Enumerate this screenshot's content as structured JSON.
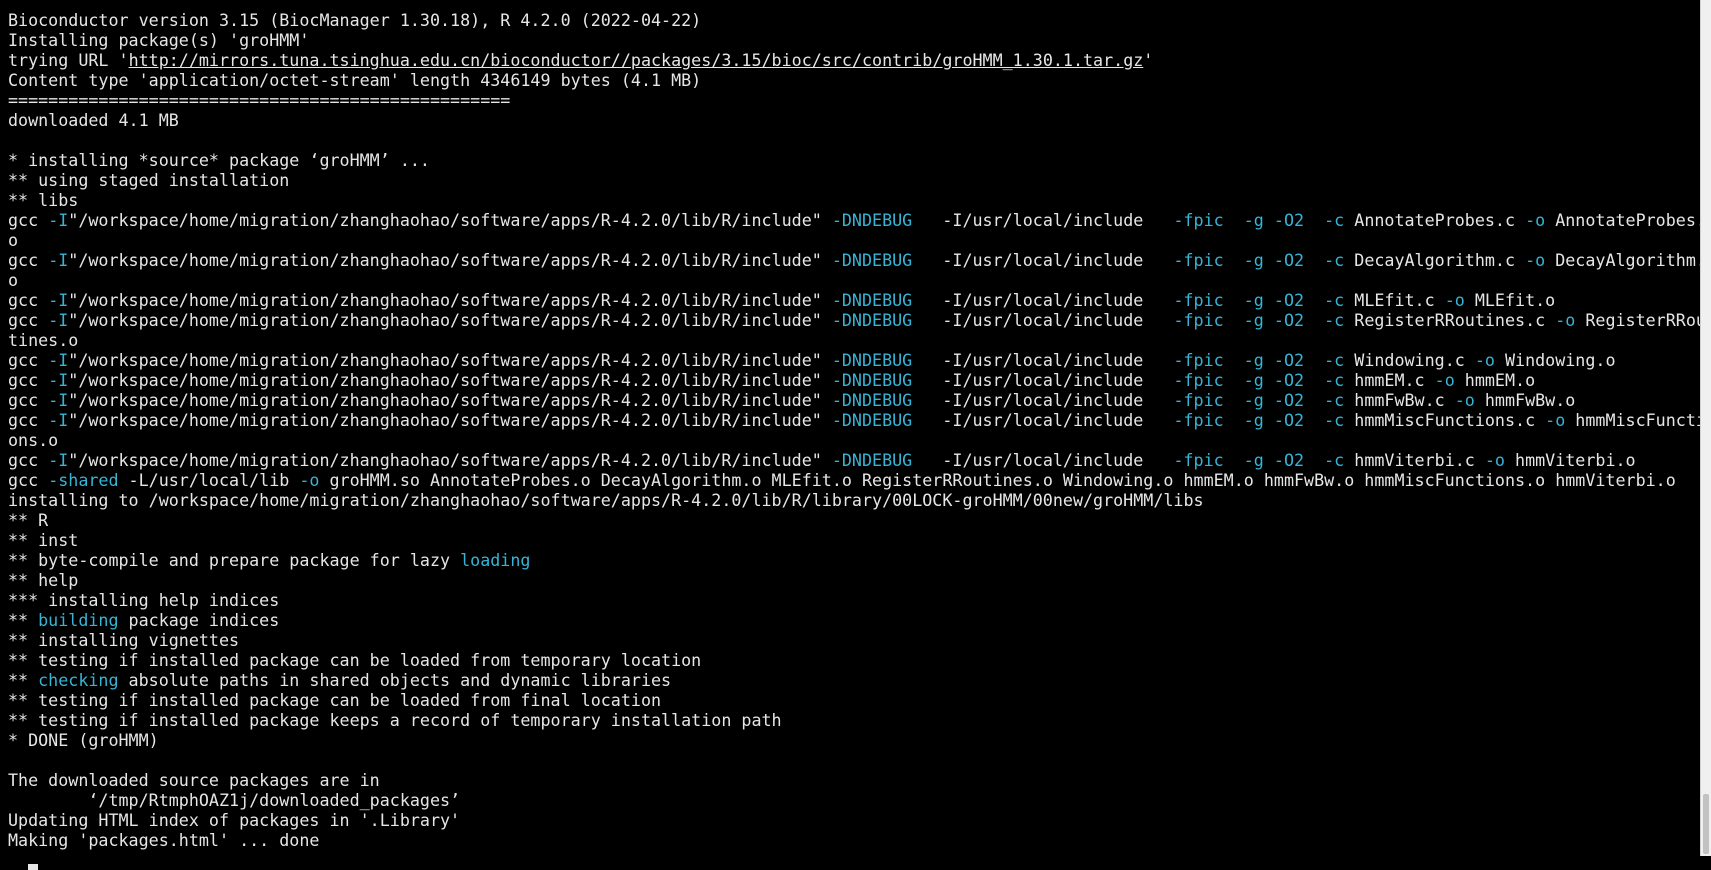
{
  "terminal": {
    "lines": [
      [
        {
          "t": "Bioconductor version 3.15 (BiocManager 1.30.18), R 4.2.0 (2022-04-22)"
        }
      ],
      [
        {
          "t": "Installing package(s) 'groHMM'"
        }
      ],
      [
        {
          "t": "trying URL '"
        },
        {
          "t": "http://mirrors.tuna.tsinghua.edu.cn/bioconductor//packages/3.15/bioc/src/contrib/groHMM_1.30.1.tar.gz",
          "c": "link"
        },
        {
          "t": "'"
        }
      ],
      [
        {
          "t": "Content type 'application/octet-stream' length 4346149 bytes (4.1 MB)"
        }
      ],
      [
        {
          "t": "=================================================="
        }
      ],
      [
        {
          "t": "downloaded 4.1 MB"
        }
      ],
      [
        {
          "t": ""
        }
      ],
      [
        {
          "t": "* installing *source* package ‘groHMM’ ..."
        }
      ],
      [
        {
          "t": "** using staged installation"
        }
      ],
      [
        {
          "t": "** libs"
        }
      ],
      [
        {
          "t": "gcc "
        },
        {
          "t": "-I",
          "c": "opt"
        },
        {
          "t": "\"/workspace/home/migration/zhanghaohao/software/apps/R-4.2.0/lib/R/include\" "
        },
        {
          "t": "-DNDEBUG",
          "c": "opt"
        },
        {
          "t": "   -I/usr/local/include   "
        },
        {
          "t": "-fpic",
          "c": "opt"
        },
        {
          "t": "  "
        },
        {
          "t": "-g",
          "c": "opt"
        },
        {
          "t": " "
        },
        {
          "t": "-O2",
          "c": "opt"
        },
        {
          "t": "  "
        },
        {
          "t": "-c",
          "c": "opt"
        },
        {
          "t": " AnnotateProbes.c "
        },
        {
          "t": "-o",
          "c": "opt"
        },
        {
          "t": " AnnotateProbes."
        }
      ],
      [
        {
          "t": "o"
        }
      ],
      [
        {
          "t": "gcc "
        },
        {
          "t": "-I",
          "c": "opt"
        },
        {
          "t": "\"/workspace/home/migration/zhanghaohao/software/apps/R-4.2.0/lib/R/include\" "
        },
        {
          "t": "-DNDEBUG",
          "c": "opt"
        },
        {
          "t": "   -I/usr/local/include   "
        },
        {
          "t": "-fpic",
          "c": "opt"
        },
        {
          "t": "  "
        },
        {
          "t": "-g",
          "c": "opt"
        },
        {
          "t": " "
        },
        {
          "t": "-O2",
          "c": "opt"
        },
        {
          "t": "  "
        },
        {
          "t": "-c",
          "c": "opt"
        },
        {
          "t": " DecayAlgorithm.c "
        },
        {
          "t": "-o",
          "c": "opt"
        },
        {
          "t": " DecayAlgorithm."
        }
      ],
      [
        {
          "t": "o"
        }
      ],
      [
        {
          "t": "gcc "
        },
        {
          "t": "-I",
          "c": "opt"
        },
        {
          "t": "\"/workspace/home/migration/zhanghaohao/software/apps/R-4.2.0/lib/R/include\" "
        },
        {
          "t": "-DNDEBUG",
          "c": "opt"
        },
        {
          "t": "   -I/usr/local/include   "
        },
        {
          "t": "-fpic",
          "c": "opt"
        },
        {
          "t": "  "
        },
        {
          "t": "-g",
          "c": "opt"
        },
        {
          "t": " "
        },
        {
          "t": "-O2",
          "c": "opt"
        },
        {
          "t": "  "
        },
        {
          "t": "-c",
          "c": "opt"
        },
        {
          "t": " MLEfit.c "
        },
        {
          "t": "-o",
          "c": "opt"
        },
        {
          "t": " MLEfit.o"
        }
      ],
      [
        {
          "t": "gcc "
        },
        {
          "t": "-I",
          "c": "opt"
        },
        {
          "t": "\"/workspace/home/migration/zhanghaohao/software/apps/R-4.2.0/lib/R/include\" "
        },
        {
          "t": "-DNDEBUG",
          "c": "opt"
        },
        {
          "t": "   -I/usr/local/include   "
        },
        {
          "t": "-fpic",
          "c": "opt"
        },
        {
          "t": "  "
        },
        {
          "t": "-g",
          "c": "opt"
        },
        {
          "t": " "
        },
        {
          "t": "-O2",
          "c": "opt"
        },
        {
          "t": "  "
        },
        {
          "t": "-c",
          "c": "opt"
        },
        {
          "t": " RegisterRRoutines.c "
        },
        {
          "t": "-o",
          "c": "opt"
        },
        {
          "t": " RegisterRRou"
        }
      ],
      [
        {
          "t": "tines.o"
        }
      ],
      [
        {
          "t": "gcc "
        },
        {
          "t": "-I",
          "c": "opt"
        },
        {
          "t": "\"/workspace/home/migration/zhanghaohao/software/apps/R-4.2.0/lib/R/include\" "
        },
        {
          "t": "-DNDEBUG",
          "c": "opt"
        },
        {
          "t": "   -I/usr/local/include   "
        },
        {
          "t": "-fpic",
          "c": "opt"
        },
        {
          "t": "  "
        },
        {
          "t": "-g",
          "c": "opt"
        },
        {
          "t": " "
        },
        {
          "t": "-O2",
          "c": "opt"
        },
        {
          "t": "  "
        },
        {
          "t": "-c",
          "c": "opt"
        },
        {
          "t": " Windowing.c "
        },
        {
          "t": "-o",
          "c": "opt"
        },
        {
          "t": " Windowing.o"
        }
      ],
      [
        {
          "t": "gcc "
        },
        {
          "t": "-I",
          "c": "opt"
        },
        {
          "t": "\"/workspace/home/migration/zhanghaohao/software/apps/R-4.2.0/lib/R/include\" "
        },
        {
          "t": "-DNDEBUG",
          "c": "opt"
        },
        {
          "t": "   -I/usr/local/include   "
        },
        {
          "t": "-fpic",
          "c": "opt"
        },
        {
          "t": "  "
        },
        {
          "t": "-g",
          "c": "opt"
        },
        {
          "t": " "
        },
        {
          "t": "-O2",
          "c": "opt"
        },
        {
          "t": "  "
        },
        {
          "t": "-c",
          "c": "opt"
        },
        {
          "t": " hmmEM.c "
        },
        {
          "t": "-o",
          "c": "opt"
        },
        {
          "t": " hmmEM.o"
        }
      ],
      [
        {
          "t": "gcc "
        },
        {
          "t": "-I",
          "c": "opt"
        },
        {
          "t": "\"/workspace/home/migration/zhanghaohao/software/apps/R-4.2.0/lib/R/include\" "
        },
        {
          "t": "-DNDEBUG",
          "c": "opt"
        },
        {
          "t": "   -I/usr/local/include   "
        },
        {
          "t": "-fpic",
          "c": "opt"
        },
        {
          "t": "  "
        },
        {
          "t": "-g",
          "c": "opt"
        },
        {
          "t": " "
        },
        {
          "t": "-O2",
          "c": "opt"
        },
        {
          "t": "  "
        },
        {
          "t": "-c",
          "c": "opt"
        },
        {
          "t": " hmmFwBw.c "
        },
        {
          "t": "-o",
          "c": "opt"
        },
        {
          "t": " hmmFwBw.o"
        }
      ],
      [
        {
          "t": "gcc "
        },
        {
          "t": "-I",
          "c": "opt"
        },
        {
          "t": "\"/workspace/home/migration/zhanghaohao/software/apps/R-4.2.0/lib/R/include\" "
        },
        {
          "t": "-DNDEBUG",
          "c": "opt"
        },
        {
          "t": "   -I/usr/local/include   "
        },
        {
          "t": "-fpic",
          "c": "opt"
        },
        {
          "t": "  "
        },
        {
          "t": "-g",
          "c": "opt"
        },
        {
          "t": " "
        },
        {
          "t": "-O2",
          "c": "opt"
        },
        {
          "t": "  "
        },
        {
          "t": "-c",
          "c": "opt"
        },
        {
          "t": " hmmMiscFunctions.c "
        },
        {
          "t": "-o",
          "c": "opt"
        },
        {
          "t": " hmmMiscFuncti"
        }
      ],
      [
        {
          "t": "ons.o"
        }
      ],
      [
        {
          "t": "gcc "
        },
        {
          "t": "-I",
          "c": "opt"
        },
        {
          "t": "\"/workspace/home/migration/zhanghaohao/software/apps/R-4.2.0/lib/R/include\" "
        },
        {
          "t": "-DNDEBUG",
          "c": "opt"
        },
        {
          "t": "   -I/usr/local/include   "
        },
        {
          "t": "-fpic",
          "c": "opt"
        },
        {
          "t": "  "
        },
        {
          "t": "-g",
          "c": "opt"
        },
        {
          "t": " "
        },
        {
          "t": "-O2",
          "c": "opt"
        },
        {
          "t": "  "
        },
        {
          "t": "-c",
          "c": "opt"
        },
        {
          "t": " hmmViterbi.c "
        },
        {
          "t": "-o",
          "c": "opt"
        },
        {
          "t": " hmmViterbi.o"
        }
      ],
      [
        {
          "t": "gcc "
        },
        {
          "t": "-shared",
          "c": "opt"
        },
        {
          "t": " -L/usr/local/lib "
        },
        {
          "t": "-o",
          "c": "opt"
        },
        {
          "t": " groHMM.so AnnotateProbes.o DecayAlgorithm.o MLEfit.o RegisterRRoutines.o Windowing.o hmmEM.o hmmFwBw.o hmmMiscFunctions.o hmmViterbi.o"
        }
      ],
      [
        {
          "t": "installing to /workspace/home/migration/zhanghaohao/software/apps/R-4.2.0/lib/R/library/00LOCK-groHMM/00new/groHMM/libs"
        }
      ],
      [
        {
          "t": "** R"
        }
      ],
      [
        {
          "t": "** inst"
        }
      ],
      [
        {
          "t": "** byte-compile and prepare package for lazy "
        },
        {
          "t": "loading",
          "c": "opt"
        }
      ],
      [
        {
          "t": "** help"
        }
      ],
      [
        {
          "t": "*** installing help indices"
        }
      ],
      [
        {
          "t": "** "
        },
        {
          "t": "building",
          "c": "opt"
        },
        {
          "t": " package indices"
        }
      ],
      [
        {
          "t": "** installing vignettes"
        }
      ],
      [
        {
          "t": "** testing if installed package can be loaded from temporary location"
        }
      ],
      [
        {
          "t": "** "
        },
        {
          "t": "checking",
          "c": "opt"
        },
        {
          "t": " absolute paths in shared objects and dynamic libraries"
        }
      ],
      [
        {
          "t": "** testing if installed package can be loaded from final location"
        }
      ],
      [
        {
          "t": "** testing if installed package keeps a record of temporary installation path"
        }
      ],
      [
        {
          "t": "* DONE (groHMM)"
        }
      ],
      [
        {
          "t": ""
        }
      ],
      [
        {
          "t": "The downloaded source packages are in"
        }
      ],
      [
        {
          "t": "        ‘/tmp/RtmphOAZ1j/downloaded_packages’"
        }
      ],
      [
        {
          "t": "Updating HTML index of packages in '.Library'"
        }
      ],
      [
        {
          "t": "Making 'packages.html' ... done"
        }
      ]
    ]
  },
  "colors": {
    "background": "#000000",
    "foreground": "#e6e6e6",
    "option_highlight": "#36b4d6"
  }
}
